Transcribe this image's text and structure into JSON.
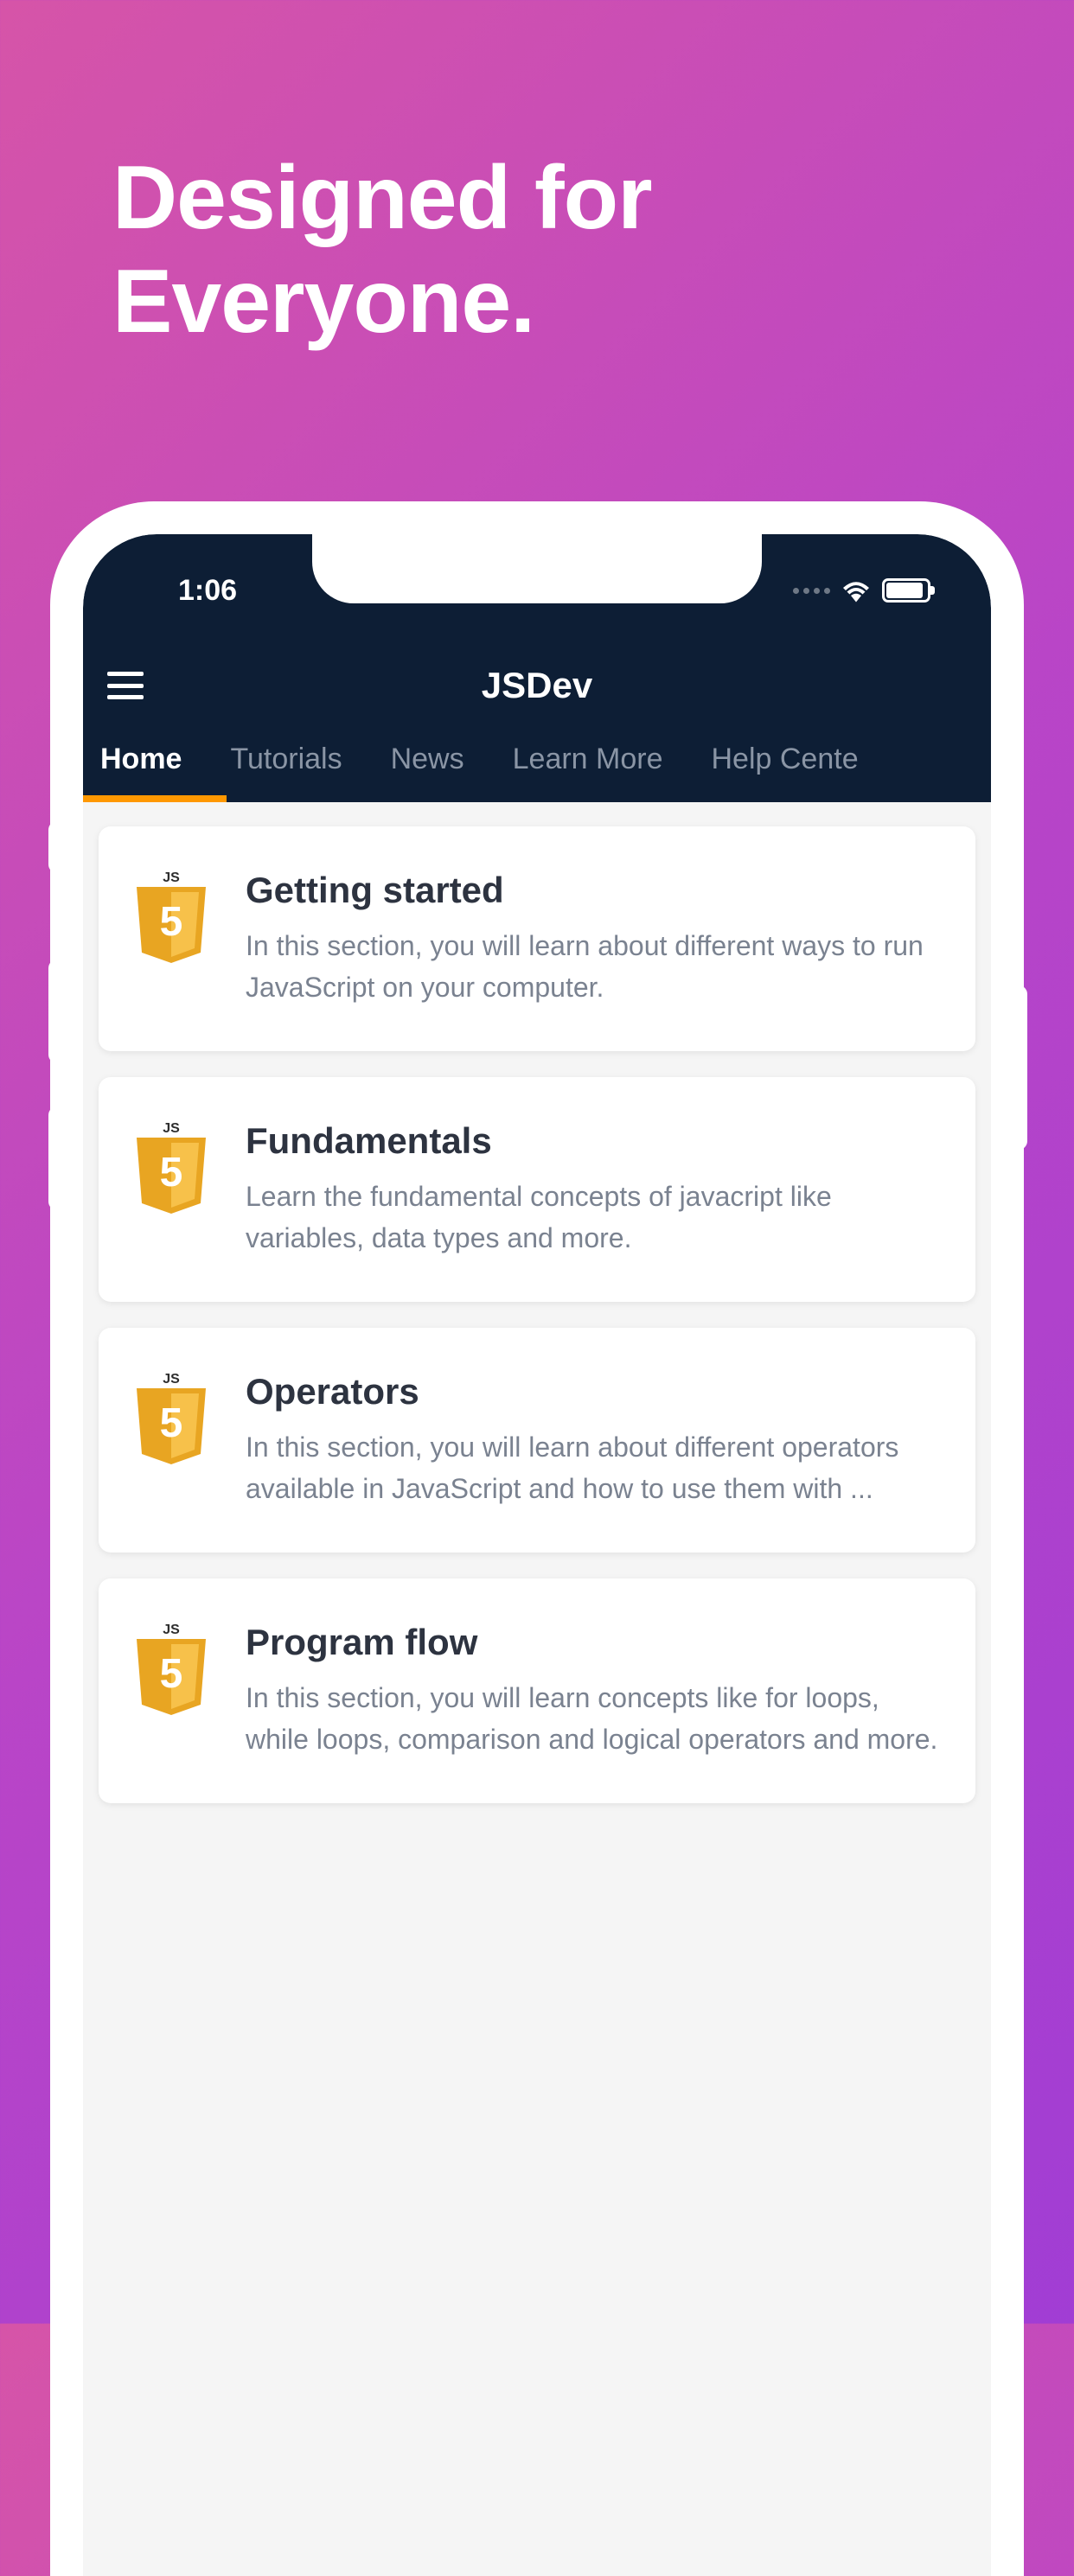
{
  "hero": {
    "title": "Designed for\nEveryone."
  },
  "statusBar": {
    "time": "1:06"
  },
  "header": {
    "appTitle": "JSDev"
  },
  "tabs": [
    {
      "label": "Home",
      "active": true
    },
    {
      "label": "Tutorials",
      "active": false
    },
    {
      "label": "News",
      "active": false
    },
    {
      "label": "Learn More",
      "active": false
    },
    {
      "label": "Help Cente",
      "active": false
    }
  ],
  "cards": [
    {
      "title": "Getting started",
      "description": "In this section, you will learn about different ways to run JavaScript on your computer."
    },
    {
      "title": "Fundamentals",
      "description": "Learn the fundamental concepts of javacript like variables, data types and more."
    },
    {
      "title": "Operators",
      "description": "In this section, you will learn about different operators available in JavaScript and how to use them with ..."
    },
    {
      "title": "Program flow",
      "description": "In this section, you will learn concepts like for loops, while loops, comparison and logical operators and more."
    }
  ]
}
